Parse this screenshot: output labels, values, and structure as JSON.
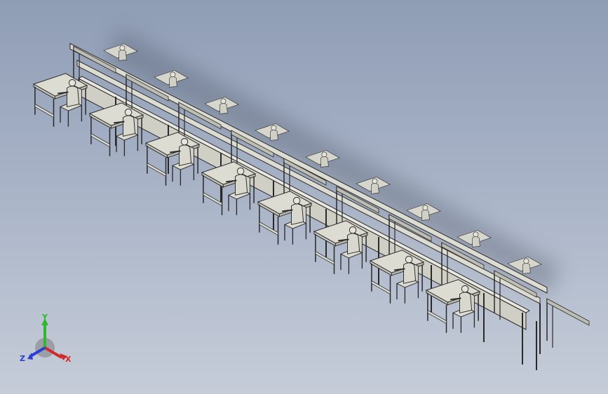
{
  "view": {
    "background_top": "#8f9db5",
    "background_bottom": "#c6cdd9",
    "model_color": "#dcdcd2",
    "edge_color": "#2a2a2a"
  },
  "assembly_line": {
    "workstations_front_row": 8,
    "workstations_back_row": 9,
    "icons": [
      "conveyor-belt",
      "workbench",
      "chair",
      "worker-figure"
    ]
  },
  "triad": {
    "y_label": "Y",
    "x_label": "X",
    "z_label": "Z",
    "y_color": "#2fb82f",
    "x_color": "#d12a2a",
    "z_color": "#2a3fd1"
  }
}
